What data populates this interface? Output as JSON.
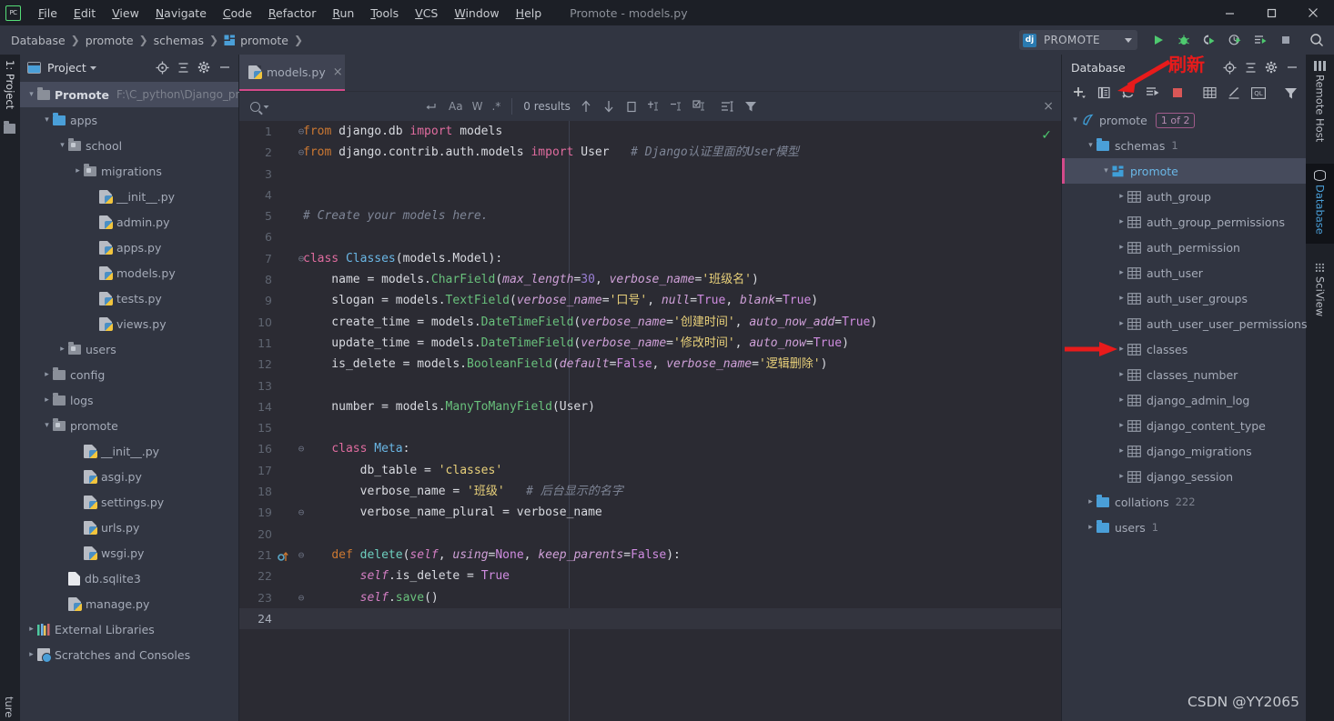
{
  "titlebar": {
    "logo": "PC",
    "menus": [
      "File",
      "Edit",
      "View",
      "Navigate",
      "Code",
      "Refactor",
      "Run",
      "Tools",
      "VCS",
      "Window",
      "Help"
    ],
    "window_title": "Promote - models.py",
    "minimize": "minimize-icon",
    "maximize": "maximize-icon",
    "close": "close-icon"
  },
  "navbar": {
    "breadcrumbs": [
      "Database",
      "promote",
      "schemas",
      "promote"
    ],
    "separator": "❯",
    "run_config": {
      "label": "PROMOTE",
      "icon_text": "dj"
    },
    "buttons": [
      "run-icon",
      "debug-icon",
      "coverage-icon",
      "profile-icon",
      "run-with-console-icon",
      "stop-icon",
      "search-everywhere-icon"
    ]
  },
  "left_strip": {
    "project_label": "1: Project",
    "bottom_label": "ture"
  },
  "right_strip": {
    "items": [
      "Remote Host",
      "Database",
      "SciView"
    ],
    "active": "Database"
  },
  "project_panel": {
    "title": "Project",
    "header_buttons": [
      "locate-icon",
      "collapse-all-icon",
      "settings-icon",
      "hide-icon"
    ],
    "root": {
      "label": "Promote",
      "path": "F:\\C_python\\Django_pro"
    },
    "tree": [
      {
        "label": "apps",
        "indent": 1,
        "arrow": "down",
        "icon": "folder",
        "type": "folder"
      },
      {
        "label": "school",
        "indent": 2,
        "arrow": "down",
        "icon": "package",
        "type": "package"
      },
      {
        "label": "migrations",
        "indent": 3,
        "arrow": "right",
        "icon": "package",
        "type": "package"
      },
      {
        "label": "__init__.py",
        "indent": 4,
        "arrow": "none",
        "icon": "python",
        "type": "file"
      },
      {
        "label": "admin.py",
        "indent": 4,
        "arrow": "none",
        "icon": "python",
        "type": "file"
      },
      {
        "label": "apps.py",
        "indent": 4,
        "arrow": "none",
        "icon": "python",
        "type": "file"
      },
      {
        "label": "models.py",
        "indent": 4,
        "arrow": "none",
        "icon": "python",
        "type": "file"
      },
      {
        "label": "tests.py",
        "indent": 4,
        "arrow": "none",
        "icon": "python",
        "type": "file"
      },
      {
        "label": "views.py",
        "indent": 4,
        "arrow": "none",
        "icon": "python",
        "type": "file"
      },
      {
        "label": "users",
        "indent": 2,
        "arrow": "right",
        "icon": "package",
        "type": "package"
      },
      {
        "label": "config",
        "indent": 1,
        "arrow": "right",
        "icon": "folder-gray",
        "type": "folder"
      },
      {
        "label": "logs",
        "indent": 1,
        "arrow": "right",
        "icon": "folder-gray",
        "type": "folder"
      },
      {
        "label": "promote",
        "indent": 1,
        "arrow": "down",
        "icon": "package",
        "type": "package"
      },
      {
        "label": "__init__.py",
        "indent": 3,
        "arrow": "none",
        "icon": "python",
        "type": "file"
      },
      {
        "label": "asgi.py",
        "indent": 3,
        "arrow": "none",
        "icon": "python",
        "type": "file"
      },
      {
        "label": "settings.py",
        "indent": 3,
        "arrow": "none",
        "icon": "python",
        "type": "file"
      },
      {
        "label": "urls.py",
        "indent": 3,
        "arrow": "none",
        "icon": "python",
        "type": "file"
      },
      {
        "label": "wsgi.py",
        "indent": 3,
        "arrow": "none",
        "icon": "python",
        "type": "file"
      },
      {
        "label": "db.sqlite3",
        "indent": 2,
        "arrow": "none",
        "icon": "file",
        "type": "file"
      },
      {
        "label": "manage.py",
        "indent": 2,
        "arrow": "none",
        "icon": "python",
        "type": "file"
      },
      {
        "label": "External Libraries",
        "indent": 0,
        "arrow": "right",
        "icon": "library",
        "type": "node"
      },
      {
        "label": "Scratches and Consoles",
        "indent": 0,
        "arrow": "right",
        "icon": "scratch",
        "type": "node"
      }
    ]
  },
  "editor": {
    "tab": {
      "name": "models.py",
      "close": "×",
      "icon": "python-file-icon"
    },
    "findbar": {
      "search_value": "",
      "search_placeholder": "",
      "options": [
        "Aa",
        "W",
        ".*"
      ],
      "results": "0 results",
      "icons": [
        "history-icon",
        "prev-match-icon",
        "next-match-icon",
        "select-all-icon",
        "add-selection-icon",
        "remove-selection-icon",
        "select-occurrences-icon",
        "find-in-selection-icon",
        "filter-icon"
      ],
      "close": "×"
    },
    "status_ok": "✓",
    "current_line": 24,
    "lines": [
      {
        "n": 1,
        "fold": "⊖",
        "tokens": [
          [
            "kw",
            "from"
          ],
          [
            "pl",
            " django.db "
          ],
          [
            "imp",
            "import"
          ],
          [
            "pl",
            " models"
          ]
        ]
      },
      {
        "n": 2,
        "fold": "⊖",
        "tokens": [
          [
            "kw",
            "from"
          ],
          [
            "pl",
            " django.contrib.auth.models "
          ],
          [
            "imp",
            "import"
          ],
          [
            "pl",
            " User   "
          ],
          [
            "cm",
            "# Django认证里面的User模型"
          ]
        ]
      },
      {
        "n": 3,
        "fold": "",
        "tokens": []
      },
      {
        "n": 4,
        "fold": "",
        "tokens": []
      },
      {
        "n": 5,
        "fold": "",
        "tokens": [
          [
            "cm",
            "# Create your models here."
          ]
        ]
      },
      {
        "n": 6,
        "fold": "",
        "tokens": []
      },
      {
        "n": 7,
        "fold": "⊖",
        "tokens": [
          [
            "kw2",
            "class"
          ],
          [
            "pl",
            " "
          ],
          [
            "cls",
            "Classes"
          ],
          [
            "pl",
            "(models.Model):"
          ]
        ]
      },
      {
        "n": 8,
        "fold": "",
        "tokens": [
          [
            "pl",
            "    name = models."
          ],
          [
            "mth",
            "CharField"
          ],
          [
            "pl",
            "("
          ],
          [
            "par",
            "max_length"
          ],
          [
            "pl",
            "="
          ],
          [
            "num",
            "30"
          ],
          [
            "pl",
            ", "
          ],
          [
            "par",
            "verbose_name"
          ],
          [
            "pl",
            "="
          ],
          [
            "str",
            "'班级名'"
          ],
          [
            "pl",
            ")"
          ]
        ]
      },
      {
        "n": 9,
        "fold": "",
        "tokens": [
          [
            "pl",
            "    slogan = models."
          ],
          [
            "mth",
            "TextField"
          ],
          [
            "pl",
            "("
          ],
          [
            "par",
            "verbose_name"
          ],
          [
            "pl",
            "="
          ],
          [
            "str",
            "'口号'"
          ],
          [
            "pl",
            ", "
          ],
          [
            "par",
            "null"
          ],
          [
            "pl",
            "="
          ],
          [
            "kwp",
            "True"
          ],
          [
            "pl",
            ", "
          ],
          [
            "par",
            "blank"
          ],
          [
            "pl",
            "="
          ],
          [
            "kwp",
            "True"
          ],
          [
            "pl",
            ")"
          ]
        ]
      },
      {
        "n": 10,
        "fold": "",
        "tokens": [
          [
            "pl",
            "    create_time = models."
          ],
          [
            "mth",
            "DateTimeField"
          ],
          [
            "pl",
            "("
          ],
          [
            "par",
            "verbose_name"
          ],
          [
            "pl",
            "="
          ],
          [
            "str",
            "'创建时间'"
          ],
          [
            "pl",
            ", "
          ],
          [
            "par",
            "auto_now_add"
          ],
          [
            "pl",
            "="
          ],
          [
            "kwp",
            "True"
          ],
          [
            "pl",
            ")"
          ]
        ]
      },
      {
        "n": 11,
        "fold": "",
        "tokens": [
          [
            "pl",
            "    update_time = models."
          ],
          [
            "mth",
            "DateTimeField"
          ],
          [
            "pl",
            "("
          ],
          [
            "par",
            "verbose_name"
          ],
          [
            "pl",
            "="
          ],
          [
            "str",
            "'修改时间'"
          ],
          [
            "pl",
            ", "
          ],
          [
            "par",
            "auto_now"
          ],
          [
            "pl",
            "="
          ],
          [
            "kwp",
            "True"
          ],
          [
            "pl",
            ")"
          ]
        ]
      },
      {
        "n": 12,
        "fold": "",
        "tokens": [
          [
            "pl",
            "    is_delete = models."
          ],
          [
            "mth",
            "BooleanField"
          ],
          [
            "pl",
            "("
          ],
          [
            "par",
            "default"
          ],
          [
            "pl",
            "="
          ],
          [
            "kwp",
            "False"
          ],
          [
            "pl",
            ", "
          ],
          [
            "par",
            "verbose_name"
          ],
          [
            "pl",
            "="
          ],
          [
            "str",
            "'逻辑删除'"
          ],
          [
            "pl",
            ")"
          ]
        ]
      },
      {
        "n": 13,
        "fold": "",
        "tokens": []
      },
      {
        "n": 14,
        "fold": "",
        "tokens": [
          [
            "pl",
            "    number = models."
          ],
          [
            "mth",
            "ManyToManyField"
          ],
          [
            "pl",
            "(User)"
          ]
        ]
      },
      {
        "n": 15,
        "fold": "",
        "tokens": []
      },
      {
        "n": 16,
        "fold": "⊖",
        "tokens": [
          [
            "pl",
            "    "
          ],
          [
            "kw2",
            "class"
          ],
          [
            "pl",
            " "
          ],
          [
            "cls",
            "Meta"
          ],
          [
            "pl",
            ":"
          ]
        ]
      },
      {
        "n": 17,
        "fold": "",
        "tokens": [
          [
            "pl",
            "        db_table = "
          ],
          [
            "str",
            "'classes'"
          ]
        ]
      },
      {
        "n": 18,
        "fold": "",
        "tokens": [
          [
            "pl",
            "        verbose_name = "
          ],
          [
            "str",
            "'班级'"
          ],
          [
            "pl",
            "   "
          ],
          [
            "cm",
            "# 后台显示的名字"
          ]
        ]
      },
      {
        "n": 19,
        "fold": "⊖",
        "tokens": [
          [
            "pl",
            "        verbose_name_plural = verbose_name"
          ]
        ]
      },
      {
        "n": 20,
        "fold": "",
        "tokens": []
      },
      {
        "n": 21,
        "fold": "⊖",
        "tokens": [
          [
            "pl",
            "    "
          ],
          [
            "kw",
            "def"
          ],
          [
            "pl",
            " "
          ],
          [
            "fn",
            "delete"
          ],
          [
            "pl",
            "("
          ],
          [
            "slf",
            "self"
          ],
          [
            "pl",
            ", "
          ],
          [
            "par",
            "using"
          ],
          [
            "pl",
            "="
          ],
          [
            "kwp",
            "None"
          ],
          [
            "pl",
            ", "
          ],
          [
            "par",
            "keep_parents"
          ],
          [
            "pl",
            "="
          ],
          [
            "kwp",
            "False"
          ],
          [
            "pl",
            "):"
          ]
        ],
        "marker": "override"
      },
      {
        "n": 22,
        "fold": "",
        "tokens": [
          [
            "pl",
            "        "
          ],
          [
            "slf",
            "self"
          ],
          [
            "pl",
            ".is_delete = "
          ],
          [
            "kwp",
            "True"
          ]
        ]
      },
      {
        "n": 23,
        "fold": "⊖",
        "tokens": [
          [
            "pl",
            "        "
          ],
          [
            "slf",
            "self"
          ],
          [
            "pl",
            "."
          ],
          [
            "mth",
            "save"
          ],
          [
            "pl",
            "()"
          ]
        ]
      },
      {
        "n": 24,
        "fold": "",
        "tokens": []
      }
    ]
  },
  "database_panel": {
    "title": "Database",
    "header_buttons": [
      "locate-icon",
      "collapse-all-icon",
      "settings-icon",
      "hide-icon"
    ],
    "toolbar_buttons": [
      "add-icon",
      "duplicate-icon",
      "refresh-icon",
      "run-sql-icon",
      "stop-icon",
      "table-editor-icon",
      "modify-icon",
      "qlconsole-icon",
      "filter-icon"
    ],
    "tree": [
      {
        "label": "promote",
        "indent": 0,
        "arrow": "down",
        "icon": "connection",
        "badge": "1 of 2",
        "count": ""
      },
      {
        "label": "schemas",
        "indent": 1,
        "arrow": "down",
        "icon": "folder",
        "badge": "",
        "count": "1"
      },
      {
        "label": "promote",
        "indent": 2,
        "arrow": "down",
        "icon": "schema",
        "badge": "",
        "count": "",
        "selected": true,
        "highlight": true
      },
      {
        "label": "auth_group",
        "indent": 3,
        "arrow": "right",
        "icon": "table",
        "badge": "",
        "count": ""
      },
      {
        "label": "auth_group_permissions",
        "indent": 3,
        "arrow": "right",
        "icon": "table",
        "badge": "",
        "count": ""
      },
      {
        "label": "auth_permission",
        "indent": 3,
        "arrow": "right",
        "icon": "table",
        "badge": "",
        "count": ""
      },
      {
        "label": "auth_user",
        "indent": 3,
        "arrow": "right",
        "icon": "table",
        "badge": "",
        "count": ""
      },
      {
        "label": "auth_user_groups",
        "indent": 3,
        "arrow": "right",
        "icon": "table",
        "badge": "",
        "count": ""
      },
      {
        "label": "auth_user_user_permissions",
        "indent": 3,
        "arrow": "right",
        "icon": "table",
        "badge": "",
        "count": ""
      },
      {
        "label": "classes",
        "indent": 3,
        "arrow": "right",
        "icon": "table",
        "badge": "",
        "count": "",
        "annotated": true
      },
      {
        "label": "classes_number",
        "indent": 3,
        "arrow": "right",
        "icon": "table",
        "badge": "",
        "count": ""
      },
      {
        "label": "django_admin_log",
        "indent": 3,
        "arrow": "right",
        "icon": "table",
        "badge": "",
        "count": ""
      },
      {
        "label": "django_content_type",
        "indent": 3,
        "arrow": "right",
        "icon": "table",
        "badge": "",
        "count": ""
      },
      {
        "label": "django_migrations",
        "indent": 3,
        "arrow": "right",
        "icon": "table",
        "badge": "",
        "count": ""
      },
      {
        "label": "django_session",
        "indent": 3,
        "arrow": "right",
        "icon": "table",
        "badge": "",
        "count": ""
      },
      {
        "label": "collations",
        "indent": 1,
        "arrow": "right",
        "icon": "folder",
        "badge": "",
        "count": "222"
      },
      {
        "label": "users",
        "indent": 1,
        "arrow": "right",
        "icon": "folder",
        "badge": "",
        "count": "1"
      }
    ]
  },
  "annotations": {
    "refresh_text": "刷新",
    "refresh_color": "#e81b1b",
    "watermark": "CSDN @YY2065"
  }
}
